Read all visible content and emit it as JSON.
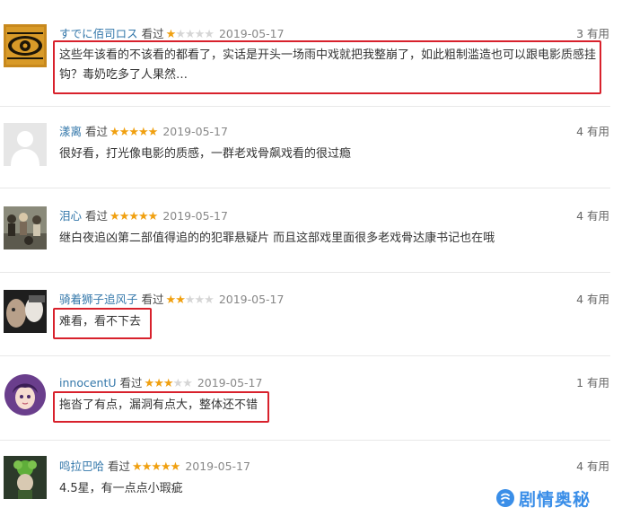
{
  "reviews": [
    {
      "user": "すでに佰司ロス",
      "status": "看过",
      "rating": 1,
      "date": "2019-05-17",
      "useful": "3 有用",
      "content": "这些年该看的不该看的都看了，实话是开头一场雨中戏就把我整崩了，如此粗制滥造也可以跟电影质感挂钩？毒奶吃多了人果然…",
      "avatar_icon": "eye-pattern-icon"
    },
    {
      "user": "漾离",
      "status": "看过",
      "rating": 5,
      "date": "2019-05-17",
      "useful": "4 有用",
      "content": "很好看，打光像电影的质感，一群老戏骨飙戏看的很过瘾",
      "avatar_icon": "default-user-icon"
    },
    {
      "user": "泪心",
      "status": "看过",
      "rating": 5,
      "date": "2019-05-17",
      "useful": "4 有用",
      "content": "继白夜追凶第二部值得追的的犯罪悬疑片 而且这部戏里面很多老戏骨达康书记也在哦",
      "avatar_icon": "group-photo-icon"
    },
    {
      "user": "骑着狮子追风子",
      "status": "看过",
      "rating": 2,
      "date": "2019-05-17",
      "useful": "4 有用",
      "content": "难看，看不下去",
      "avatar_icon": "portrait-photo-icon"
    },
    {
      "user": "innocentU",
      "status": "看过",
      "rating": 3,
      "date": "2019-05-17",
      "useful": "1 有用",
      "content": "拖沓了有点，漏洞有点大，整体还不错",
      "avatar_icon": "anime-girl-icon"
    },
    {
      "user": "鸣拉巴哈",
      "status": "看过",
      "rating": 5,
      "date": "2019-05-17",
      "useful": "4 有用",
      "content": "4.5星，有一点点小瑕疵",
      "avatar_icon": "green-figure-icon"
    }
  ],
  "watermark": {
    "text": "剧情奥秘",
    "icon": "chat-bubble-icon"
  },
  "colors": {
    "username": "#3377aa",
    "star_on": "#f0a010",
    "star_off": "#d6d6d6",
    "highlight_box": "#d8212c",
    "watermark": "#3a8ee8"
  }
}
